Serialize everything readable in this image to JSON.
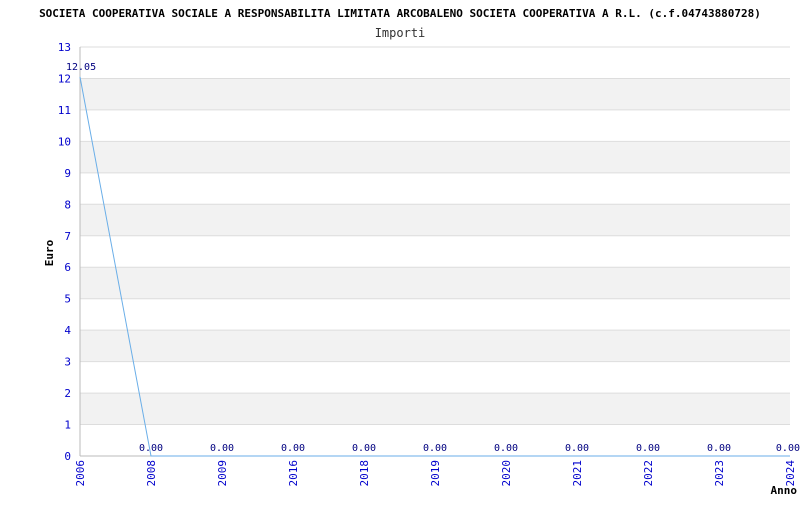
{
  "chart_data": {
    "type": "line",
    "title": "SOCIETA COOPERATIVA SOCIALE A RESPONSABILITA LIMITATA ARCOBALENO SOCIETA COOPERATIVA A R.L. (c.f.04743880728)",
    "subtitle": "Importi",
    "xlabel": "Anno",
    "ylabel": "Euro",
    "categories": [
      "2006",
      "2008",
      "2009",
      "2016",
      "2018",
      "2019",
      "2020",
      "2021",
      "2022",
      "2023",
      "2024"
    ],
    "values": [
      12.05,
      0,
      0,
      0,
      0,
      0,
      0,
      0,
      0,
      0,
      0
    ],
    "data_labels": [
      "12.05",
      "0.00",
      "0.00",
      "0.00",
      "0.00",
      "0.00",
      "0.00",
      "0.00",
      "0.00",
      "0.00",
      "0.00"
    ],
    "ylim": [
      0,
      13
    ],
    "yticks": [
      "0",
      "1",
      "2",
      "3",
      "4",
      "5",
      "6",
      "7",
      "8",
      "9",
      "10",
      "11",
      "12",
      "13"
    ],
    "grid": true,
    "colors": {
      "line": "#6aaee8",
      "band": "#f2f2f2",
      "grid": "#dddddd",
      "tick_text": "#0000cc"
    }
  }
}
